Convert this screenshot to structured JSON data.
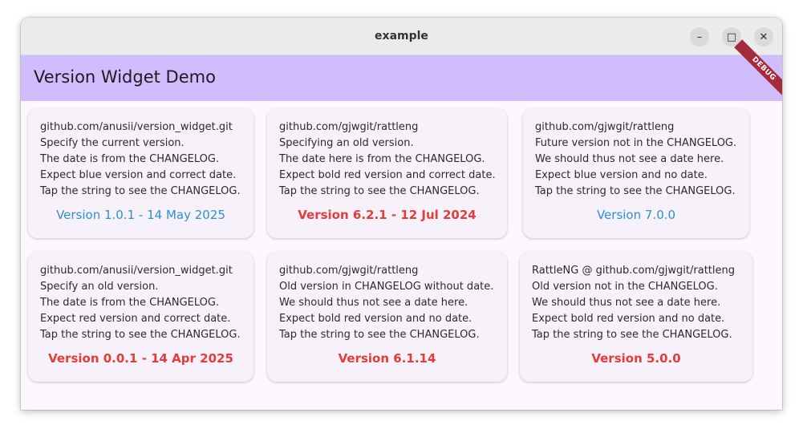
{
  "window": {
    "title": "example",
    "controls": {
      "minimize": "–",
      "maximize": "□",
      "close": "✕"
    }
  },
  "appbar": {
    "title": "Version Widget Demo",
    "banner": "DEBUG"
  },
  "colors": {
    "appbar": "#d1bcfd",
    "version_blue": "#2f8ede",
    "version_red": "#e53c3a",
    "debug_banner": "#a52a3a"
  },
  "cards": [
    {
      "lines": [
        "github.com/anusii/version_widget.git",
        "Specify the current version.",
        "The date is from the CHANGELOG.",
        "Expect blue version and correct date.",
        "Tap the string to see the CHANGELOG."
      ],
      "version": "Version 1.0.1 - 14 May 2025",
      "style": "blue"
    },
    {
      "lines": [
        "github.com/gjwgit/rattleng",
        "Specifying an old version.",
        "The date here is from the CHANGELOG.",
        "Expect bold red version and correct date.",
        "Tap the string to see the CHANGELOG."
      ],
      "version": "Version 6.2.1 - 12 Jul 2024",
      "style": "red"
    },
    {
      "lines": [
        "github.com/gjwgit/rattleng",
        "Future version not in the CHANGELOG.",
        "We should thus not see a date here.",
        "Expect blue version and no date.",
        "Tap the string to see the CHANGELOG."
      ],
      "version": "Version 7.0.0",
      "style": "blue"
    },
    {
      "lines": [
        "github.com/anusii/version_widget.git",
        "Specify an old version.",
        "The date is from the CHANGELOG.",
        "Expect red version and correct date.",
        "Tap the string to see the CHANGELOG."
      ],
      "version": "Version 0.0.1 - 14 Apr 2025",
      "style": "red"
    },
    {
      "lines": [
        "github.com/gjwgit/rattleng",
        "Old version in CHANGELOG without date.",
        "We should thus not see a date here.",
        "Expect bold red version and no date.",
        "Tap the string to see the CHANGELOG."
      ],
      "version": "Version 6.1.14",
      "style": "red"
    },
    {
      "lines": [
        "RattleNG @ github.com/gjwgit/rattleng",
        "Old version not in the CHANGELOG.",
        "We should thus not see a date here.",
        "Expect bold red version and no date.",
        "Tap the string to see the CHANGELOG."
      ],
      "version": "Version 5.0.0",
      "style": "red"
    }
  ]
}
